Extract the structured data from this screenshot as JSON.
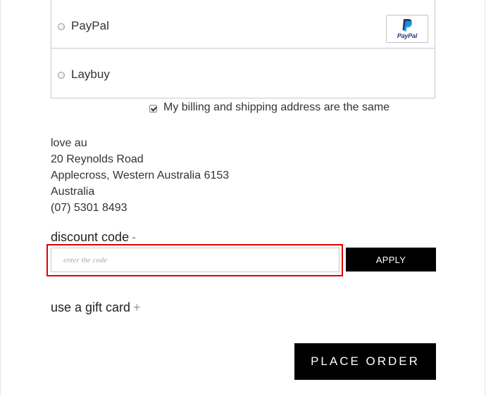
{
  "payment_methods": [
    {
      "label": "PayPal",
      "selected": false,
      "logo_text": "PayPal"
    },
    {
      "label": "Laybuy",
      "selected": false
    }
  ],
  "billing_same": {
    "label": "My billing and shipping address are the same",
    "checked": true
  },
  "address": {
    "name": "love au",
    "street": "20 Reynolds Road",
    "city_line": "Applecross, Western Australia 6153",
    "country": "Australia",
    "phone": "(07) 5301 8493"
  },
  "discount": {
    "title": "discount code",
    "toggle": "-",
    "placeholder": "enter the code",
    "value": "",
    "apply_label": "APPLY"
  },
  "gift_card": {
    "title": "use a gift card",
    "toggle": "+"
  },
  "place_order_label": "PLACE ORDER",
  "colors": {
    "button_bg": "#000000",
    "highlight": "#e00000",
    "paypal_blue": "#253b80",
    "paypal_light": "#179bd7"
  },
  "icons": {
    "paypal": "paypal-logo-icon",
    "checkbox": "checkmark-icon"
  }
}
